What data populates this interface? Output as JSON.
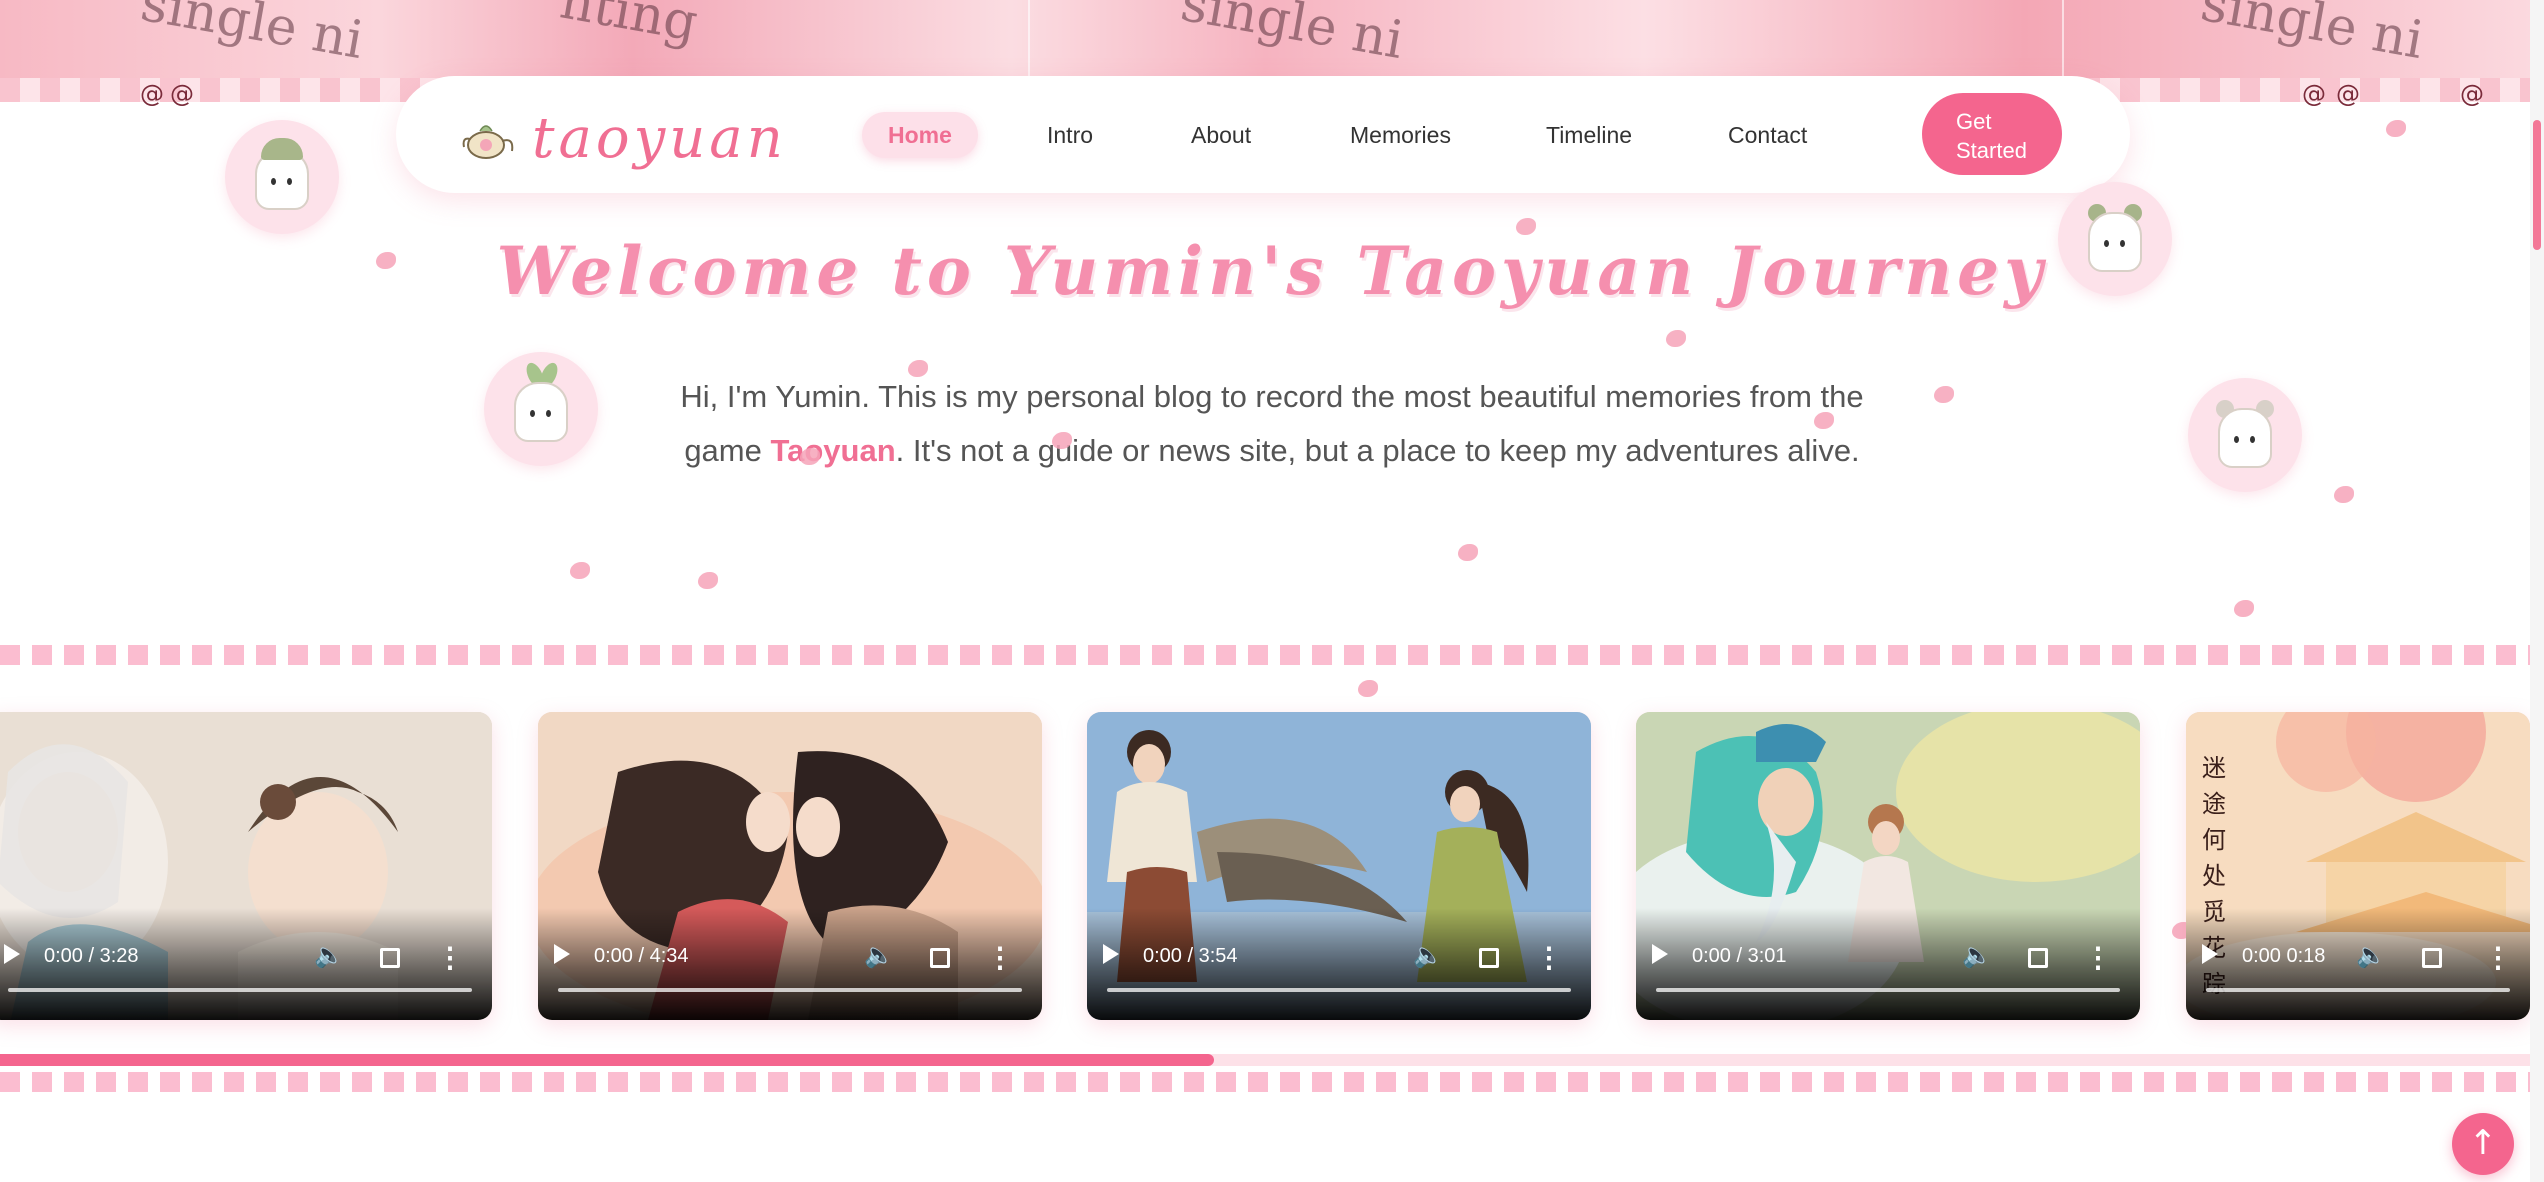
{
  "brand": {
    "name": "taoyuan"
  },
  "nav": {
    "items": [
      {
        "label": "Home",
        "active": true
      },
      {
        "label": "Intro",
        "active": false
      },
      {
        "label": "About",
        "active": false
      },
      {
        "label": "Memories",
        "active": false
      },
      {
        "label": "Timeline",
        "active": false
      },
      {
        "label": "Contact",
        "active": false
      }
    ],
    "cta_line1": "Get",
    "cta_line2": "Started"
  },
  "banner": {
    "script_text": "single ni",
    "script_text_2": "nting"
  },
  "hero": {
    "title": "Welcome to Yumin's Taoyuan Journey",
    "text_before": "Hi, I'm Yumin. This is my personal blog to record the most beautiful memories from the game ",
    "text_highlight": "Taoyuan",
    "text_after": ". It's not a guide or news site, but a place to keep my adventures alive."
  },
  "videos": [
    {
      "time": "0:00 / 3:28",
      "scene": "elder-and-girl"
    },
    {
      "time": "0:00 / 4:34",
      "scene": "two-figures-foreheads"
    },
    {
      "time": "0:00 / 3:54",
      "scene": "boy-and-girl-dancing"
    },
    {
      "time": "0:00 / 3:01",
      "scene": "sage-and-child"
    },
    {
      "time": "0:00 0:18",
      "scene": "pavilion-blossoms",
      "vertical_text": "迷途何处觅花踪"
    }
  ],
  "carousel_progress": 0.48,
  "colors": {
    "accent": "#f4658e",
    "accent_light": "#fde0e9",
    "title": "#f58fae"
  },
  "icons": {
    "back_to_top": "arrow-up-icon",
    "volume": "volume-icon",
    "fullscreen": "fullscreen-icon",
    "more": "more-vertical-icon",
    "play": "play-icon"
  }
}
